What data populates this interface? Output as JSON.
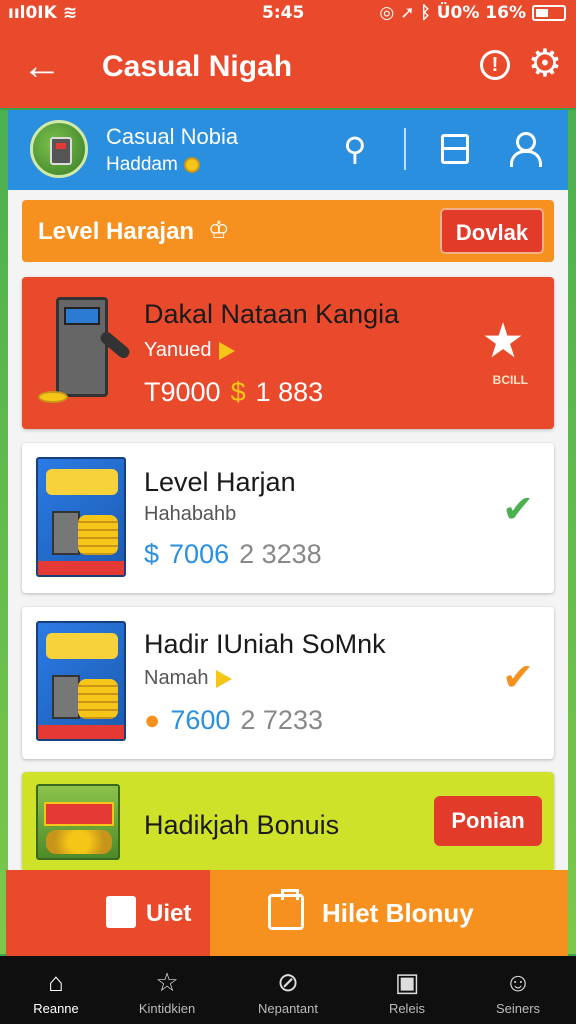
{
  "status_bar": {
    "carrier": "ııl0IK",
    "time": "5:45",
    "battery": "Ü0% 16%"
  },
  "app_bar": {
    "title": "Casual Nigah",
    "back_icon": "arrow-left-icon",
    "info_icon": "info-icon",
    "settings_icon": "gear-icon"
  },
  "profile": {
    "name": "Casual Nobia",
    "subtitle": "Haddam"
  },
  "level_bar": {
    "label": "Level Harajan",
    "button": "Dovlak"
  },
  "cards": [
    {
      "title": "Dakal Nataan Kangia",
      "subtitle": "Yanued",
      "price_a": "T9000",
      "price_b": "1 883",
      "badge": "BCILL"
    },
    {
      "title": "Level Harjan",
      "subtitle": "Hahabahb",
      "price_a": "7006",
      "price_b": "2 3238"
    },
    {
      "title": "Hadir IUniah SoMnk",
      "subtitle": "Namah",
      "price_a": "7600",
      "price_b": "2 7233"
    },
    {
      "title": "Hadikjah Bonuis",
      "button": "Ponian"
    }
  ],
  "actions": {
    "left": "Uiet",
    "right": "Hilet Blonuy"
  },
  "bottom_nav": [
    {
      "label": "Reanne",
      "icon": "home-icon"
    },
    {
      "label": "Kintidkien",
      "icon": "star-icon"
    },
    {
      "label": "Nepantant",
      "icon": "check-circle-icon"
    },
    {
      "label": "Releis",
      "icon": "box-icon"
    },
    {
      "label": "Seiners",
      "icon": "user-icon"
    }
  ],
  "colors": {
    "header_red": "#ea4a2c",
    "profile_blue": "#2b8fe0",
    "accent_orange": "#f6901e",
    "bonus_lime": "#cfe22a",
    "nav_black": "#0f0f0f"
  }
}
